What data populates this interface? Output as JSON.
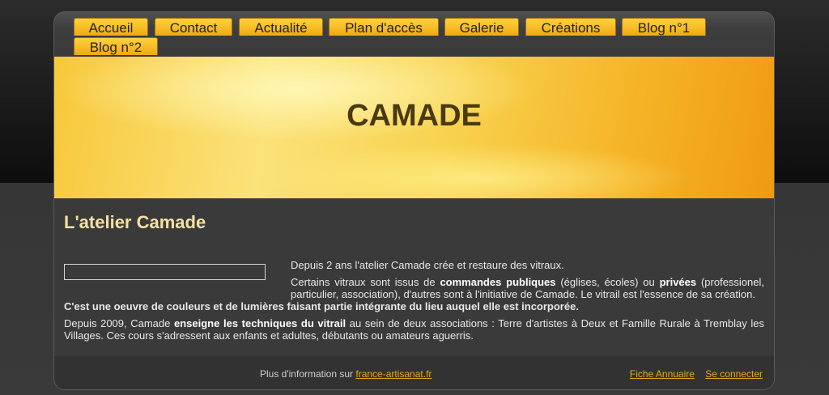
{
  "nav": {
    "items": [
      {
        "label": "Accueil"
      },
      {
        "label": "Contact"
      },
      {
        "label": "Actualité"
      },
      {
        "label": "Plan d'accès"
      },
      {
        "label": "Galerie"
      },
      {
        "label": "Créations"
      },
      {
        "label": "Blog n°1"
      },
      {
        "label": "Blog n°2"
      }
    ]
  },
  "banner": {
    "title": "CAMADE"
  },
  "main": {
    "title": "L'atelier Camade",
    "p1": "Depuis 2 ans l'atelier Camade crée et restaure des vitraux.",
    "p2": {
      "a": "Certains vitraux sont issus de ",
      "b1": "commandes publiques",
      "c": " (églises, écoles) ou ",
      "b2": "privées",
      "d": " (professionel, particulier, association), d'autres sont à l'initiative de Camade. Le vitrail est l'essence de sa création."
    },
    "p3": "C'est une oeuvre de couleurs et de lumières faisant partie intégrante du lieu auquel elle est incorporée.",
    "p4": {
      "a": "Depuis 2009, Camade ",
      "b": "enseigne les techniques du vitrail",
      "c": "  au sein de deux associations : Terre d'artistes à Deux et Famille Rurale à Tremblay les Villages. Ces cours s'adressent aux enfants et adultes, débutants ou amateurs aguerris."
    }
  },
  "footer": {
    "info_prefix": "Plus d'information sur",
    "info_link": "france-artisanat.fr",
    "links": [
      "Fiche Annuaire",
      "Se connecter"
    ]
  },
  "colors": {
    "accent": "#f0a912",
    "title": "#f6e1a3",
    "link": "#e8a81b"
  }
}
